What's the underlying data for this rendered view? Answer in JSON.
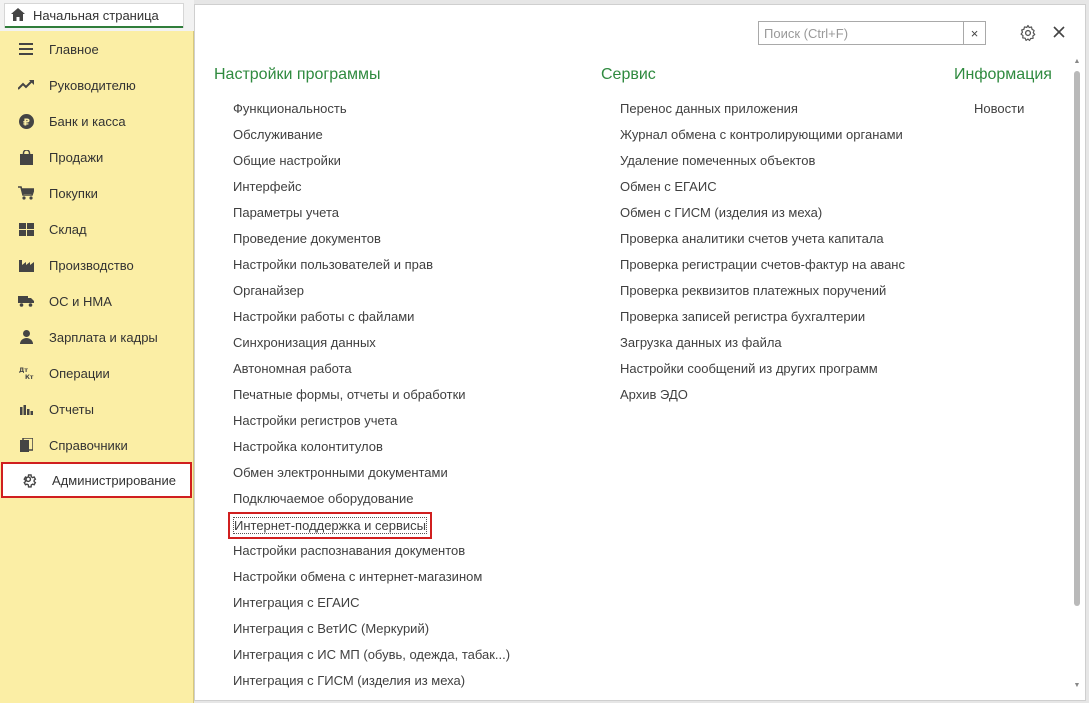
{
  "tabs": {
    "home_label": "Начальная страница"
  },
  "sidebar": {
    "items": [
      {
        "label": "Главное",
        "icon": "menu-lines-icon"
      },
      {
        "label": "Руководителю",
        "icon": "trend-up-icon"
      },
      {
        "label": "Банк и касса",
        "icon": "ruble-coin-icon"
      },
      {
        "label": "Продажи",
        "icon": "shopping-bag-icon"
      },
      {
        "label": "Покупки",
        "icon": "cart-icon"
      },
      {
        "label": "Склад",
        "icon": "warehouse-grid-icon"
      },
      {
        "label": "Производство",
        "icon": "factory-icon"
      },
      {
        "label": "ОС и НМА",
        "icon": "truck-icon"
      },
      {
        "label": "Зарплата и кадры",
        "icon": "person-icon"
      },
      {
        "label": "Операции",
        "icon": "debit-credit-icon"
      },
      {
        "label": "Отчеты",
        "icon": "bar-chart-icon"
      },
      {
        "label": "Справочники",
        "icon": "books-icon"
      },
      {
        "label": "Администрирование",
        "icon": "gear-icon",
        "active": true
      }
    ]
  },
  "search": {
    "placeholder": "Поиск (Ctrl+F)",
    "value": "",
    "clear_glyph": "×"
  },
  "sections": {
    "settings": {
      "title": "Настройки программы",
      "links": [
        "Функциональность",
        "Обслуживание",
        "Общие настройки",
        "Интерфейс",
        "Параметры учета",
        "Проведение документов",
        "Настройки пользователей и прав",
        "Органайзер",
        "Настройки работы с файлами",
        "Синхронизация данных",
        "Автономная работа",
        "Печатные формы, отчеты и обработки",
        "Настройки регистров учета",
        "Настройка колонтитулов",
        "Обмен электронными документами",
        "Подключаемое оборудование",
        "Интернет-поддержка и сервисы",
        "Настройки распознавания документов",
        "Настройки обмена с интернет-магазином",
        "Интеграция с ЕГАИС",
        "Интеграция с ВетИС (Меркурий)",
        "Интеграция с ИС МП (обувь, одежда, табак...)",
        "Интеграция с ГИСМ (изделия из меха)"
      ]
    },
    "service": {
      "title": "Сервис",
      "links": [
        "Перенос данных приложения",
        "Журнал обмена с контролирующими органами",
        "Удаление помеченных объектов",
        "Обмен с ЕГАИС",
        "Обмен с ГИСМ (изделия из меха)",
        "Проверка аналитики счетов учета капитала",
        "Проверка регистрации счетов-фактур на аванс",
        "Проверка реквизитов платежных поручений",
        "Проверка записей регистра бухгалтерии",
        "Загрузка данных из файла",
        "Настройки сообщений из других программ",
        "Архив ЭДО"
      ]
    },
    "info": {
      "title": "Информация",
      "links": [
        "Новости"
      ]
    }
  },
  "colors": {
    "accent_green": "#2f8a3f",
    "sidebar_bg": "#fbeea5",
    "highlight_red": "#d01f1f"
  }
}
